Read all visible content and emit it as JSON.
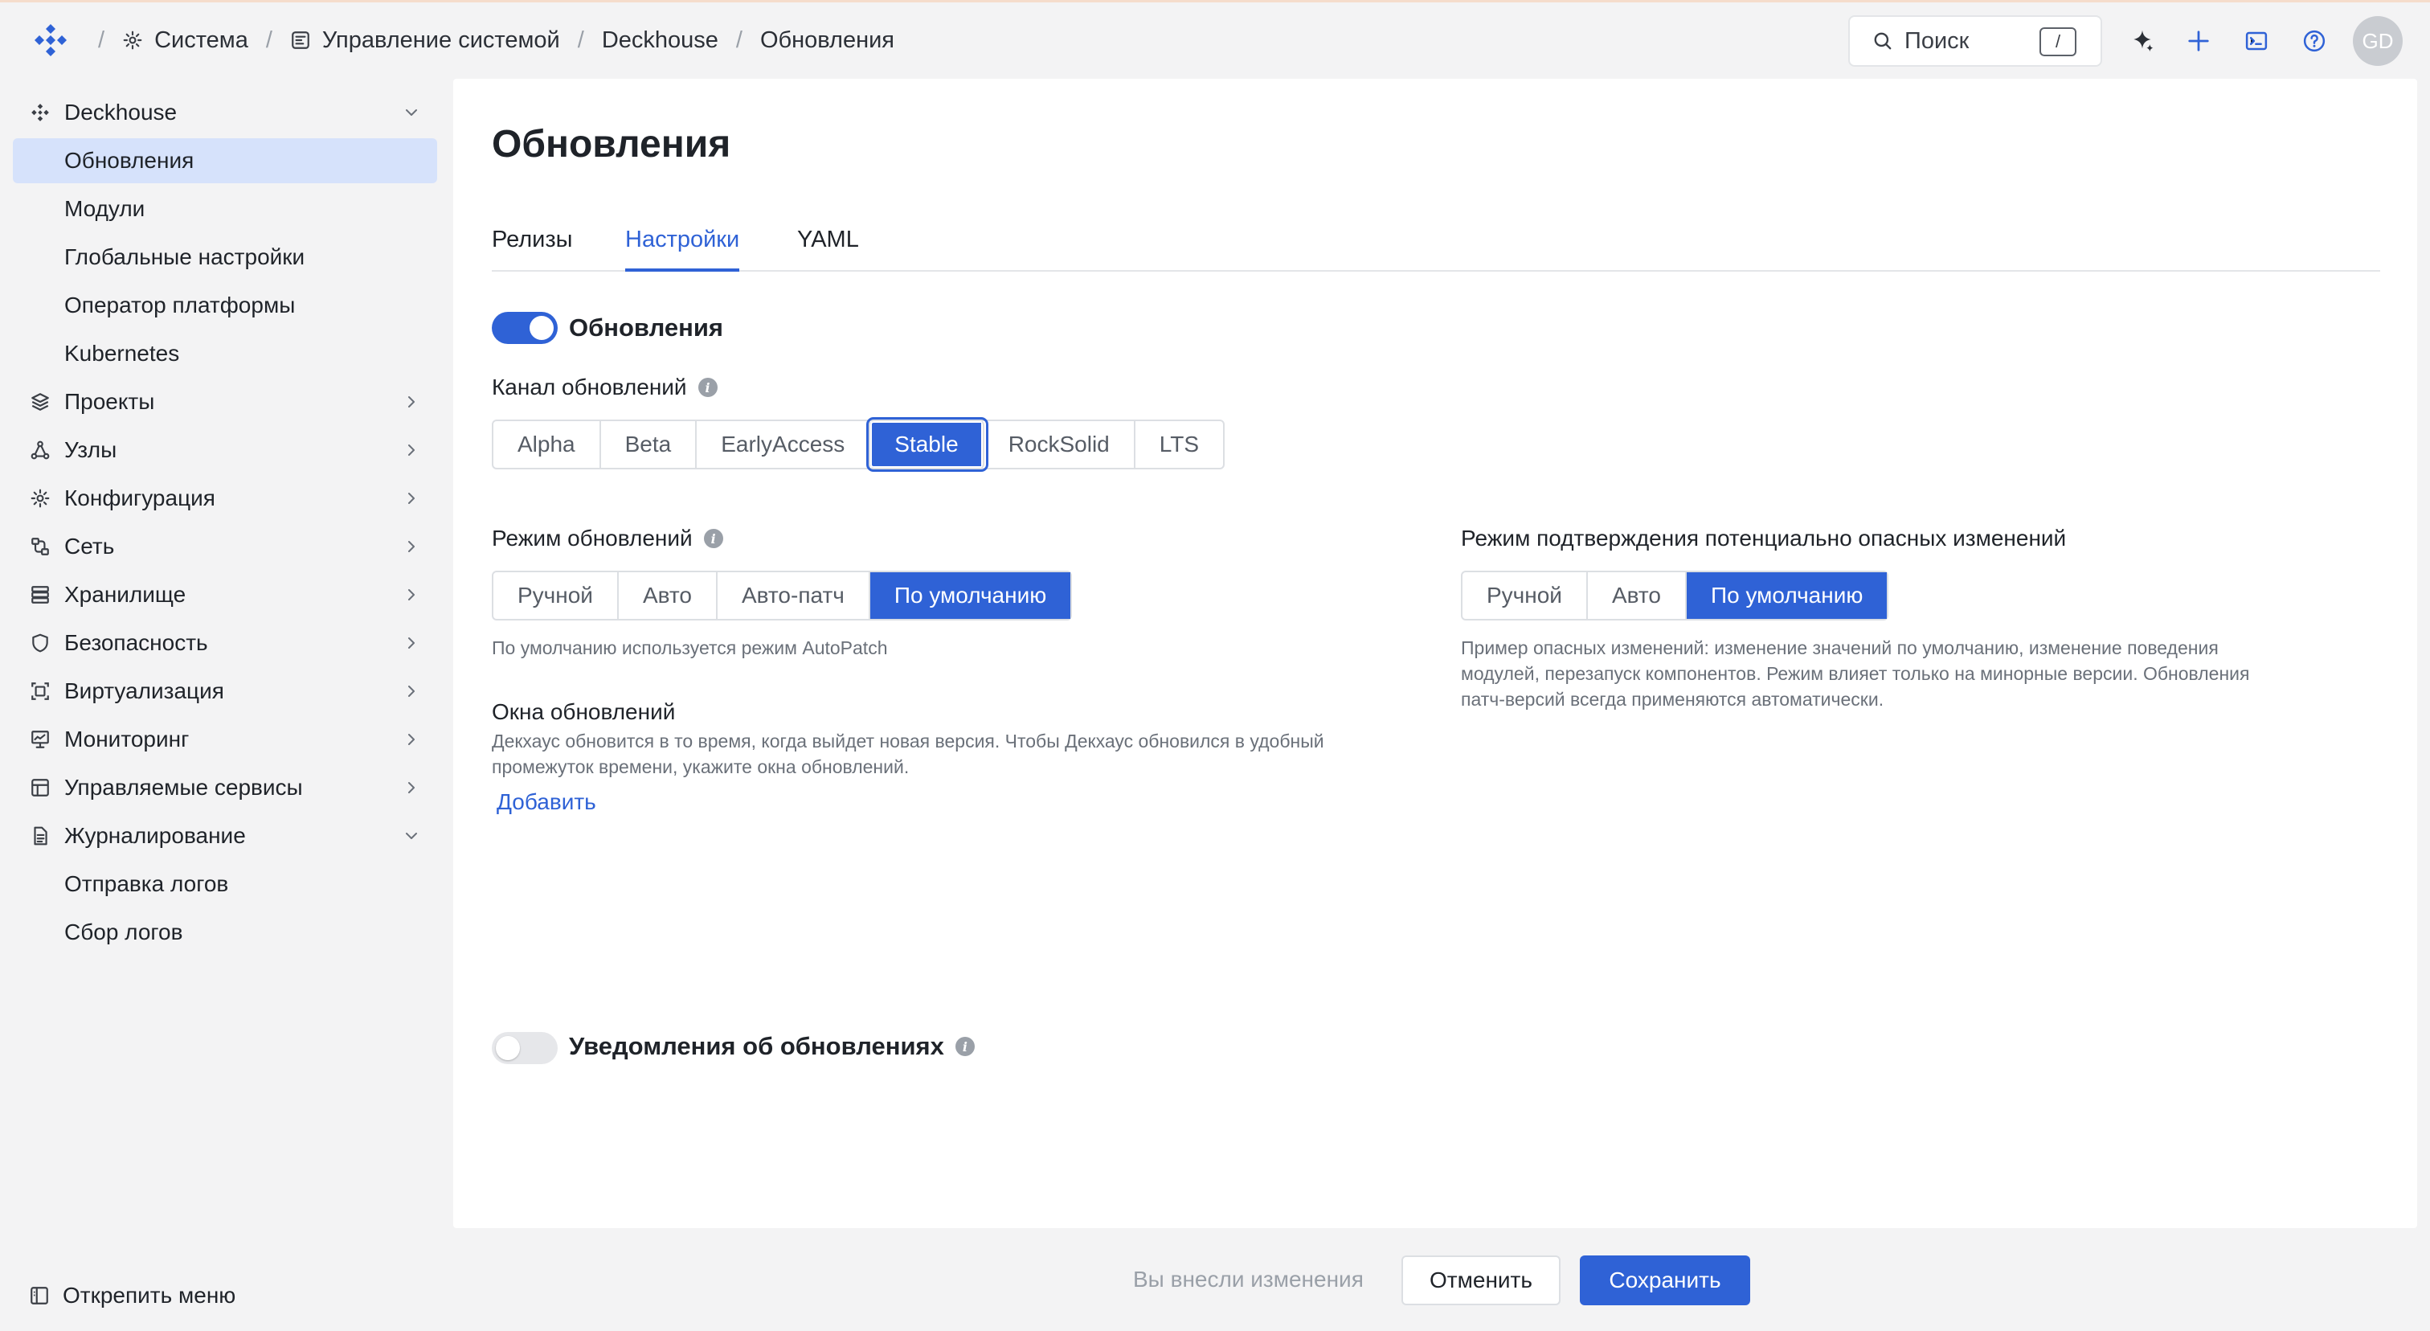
{
  "header": {
    "breadcrumbs": [
      {
        "label": "Система",
        "icon": "gear-icon"
      },
      {
        "label": "Управление системой",
        "icon": "dashboard-icon"
      },
      {
        "label": "Deckhouse"
      },
      {
        "label": "Обновления"
      }
    ],
    "separator": "/",
    "search": {
      "placeholder": "Поиск",
      "shortcut": "/"
    },
    "avatar_initials": "GD"
  },
  "sidebar": {
    "items": [
      {
        "label": "Deckhouse",
        "icon": "deckhouse-icon",
        "expanded": true
      },
      {
        "label": "Обновления",
        "active": true
      },
      {
        "label": "Модули"
      },
      {
        "label": "Глобальные настройки"
      },
      {
        "label": "Оператор платформы"
      },
      {
        "label": "Kubernetes"
      },
      {
        "label": "Проекты",
        "icon": "layers-icon"
      },
      {
        "label": "Узлы",
        "icon": "nodes-icon"
      },
      {
        "label": "Конфигурация",
        "icon": "gear-icon"
      },
      {
        "label": "Сеть",
        "icon": "network-icon"
      },
      {
        "label": "Хранилище",
        "icon": "storage-icon"
      },
      {
        "label": "Безопасность",
        "icon": "shield-icon"
      },
      {
        "label": "Виртуализация",
        "icon": "virtualization-icon"
      },
      {
        "label": "Мониторинг",
        "icon": "monitoring-icon"
      },
      {
        "label": "Управляемые сервисы",
        "icon": "services-icon"
      },
      {
        "label": "Журналирование",
        "icon": "log-icon",
        "expanded": true
      },
      {
        "label": "Отправка логов"
      },
      {
        "label": "Сбор логов"
      }
    ],
    "footer_label": "Открепить меню"
  },
  "main": {
    "title": "Обновления",
    "tabs": [
      "Релизы",
      "Настройки",
      "YAML"
    ],
    "active_tab": "Настройки",
    "updates_toggle": {
      "label": "Обновления",
      "on": true
    },
    "channel": {
      "label": "Канал обновлений",
      "options": [
        "Alpha",
        "Beta",
        "EarlyAccess",
        "Stable",
        "RockSolid",
        "LTS"
      ],
      "selected": "Stable"
    },
    "update_mode": {
      "label": "Режим обновлений",
      "options": [
        "Ручной",
        "Авто",
        "Авто-патч",
        "По умолчанию"
      ],
      "selected": "По умолчанию",
      "hint": "По умолчанию используется режим AutoPatch"
    },
    "disruption_mode": {
      "label": "Режим подтверждения потенциально опасных изменений",
      "options": [
        "Ручной",
        "Авто",
        "По умолчанию"
      ],
      "selected": "По умолчанию",
      "hint_lines": [
        "Пример опасных изменений: изменение значений по умолчанию, изменение поведения",
        "модулей, перезапуск компонентов. Режим влияет только на минорные версии. Обновления",
        "патч-версий всегда применяются автоматически."
      ]
    },
    "windows": {
      "label": "Окна обновлений",
      "hint_lines": [
        "Декхаус обновится в то время, когда выйдет новая версия. Чтобы Декхаус обновился в удобный",
        "промежуток времени, укажите окна обновлений."
      ],
      "add_label": "Добавить"
    },
    "notifications_toggle": {
      "label": "Уведомления об обновлениях",
      "on": false
    }
  },
  "footer": {
    "changes_text": "Вы внесли изменения",
    "cancel_label": "Отменить",
    "save_label": "Сохранить"
  },
  "colors": {
    "accent": "#2f62d6",
    "active_nav_bg": "#d6e2fb",
    "page_bg": "#f3f3f4"
  }
}
